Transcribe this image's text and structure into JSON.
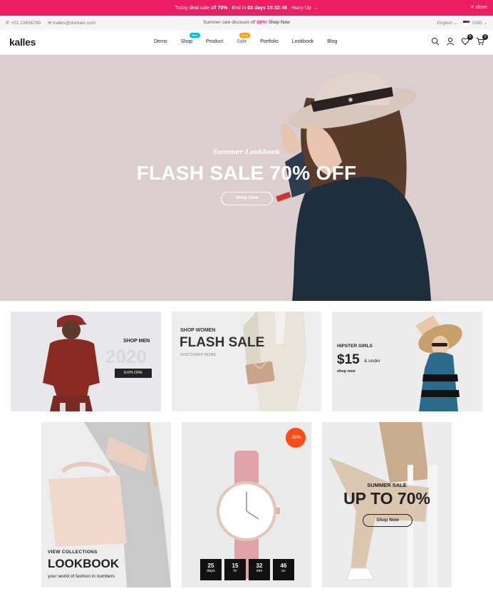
{
  "promo": {
    "text_before": "Today deal sale off",
    "percent": "70%",
    "text_mid": ". End in",
    "countdown": "03 days 15:32:46",
    "text_after": ". Hurry Up",
    "arrow": "→",
    "close_label": "✕ close"
  },
  "infobar": {
    "phone": "+01 23456789",
    "email": "Kalles@domain.com",
    "summer_text": "Summer sale discount off",
    "summer_pct": "50%",
    "summer_link": "! Shop Now",
    "language": "English",
    "currency": "USD"
  },
  "header": {
    "logo": "kalles",
    "nav": [
      {
        "label": "Demo"
      },
      {
        "label": "Shop",
        "badge": "New"
      },
      {
        "label": "Product"
      },
      {
        "label": "Sale",
        "badge": "Sale"
      },
      {
        "label": "Portfolio"
      },
      {
        "label": "Lookbook"
      },
      {
        "label": "Blog"
      }
    ],
    "wishlist_count": "0",
    "cart_count": "0"
  },
  "hero": {
    "subtitle": "Summer Lookbook",
    "title": "FLASH SALE 70% OFF",
    "button": "Shop Now"
  },
  "banners": {
    "men": {
      "label": "SHOP MEN",
      "year": "2020",
      "button": "EXPLORE"
    },
    "women": {
      "label": "SHOP WOMEN",
      "title": "FLASH SALE",
      "sub": "DISCOVERY MORE"
    },
    "hipster": {
      "label": "HIPSTER GIRLS",
      "price": "$15",
      "under": "& under",
      "link": "shop now"
    }
  },
  "row2": {
    "lookbook": {
      "label": "VIEW COLLECTIONS",
      "title": "LOOKBOOK",
      "sub": "your world of fashion in numbers"
    },
    "watch": {
      "discount": "-33%",
      "countdown": [
        {
          "num": "25",
          "unit": "days"
        },
        {
          "num": "15",
          "unit": "hr"
        },
        {
          "num": "32",
          "unit": "min"
        },
        {
          "num": "46",
          "unit": "sc"
        }
      ]
    },
    "summer": {
      "label": "SUMMER SALE",
      "title": "UP TO 70%",
      "button": "Shop Now"
    }
  },
  "colors": {
    "accent": "#ec1d63",
    "badge_new": "#01bad4",
    "badge_sale": "#ff9a00",
    "discount": "#fe4c16"
  }
}
